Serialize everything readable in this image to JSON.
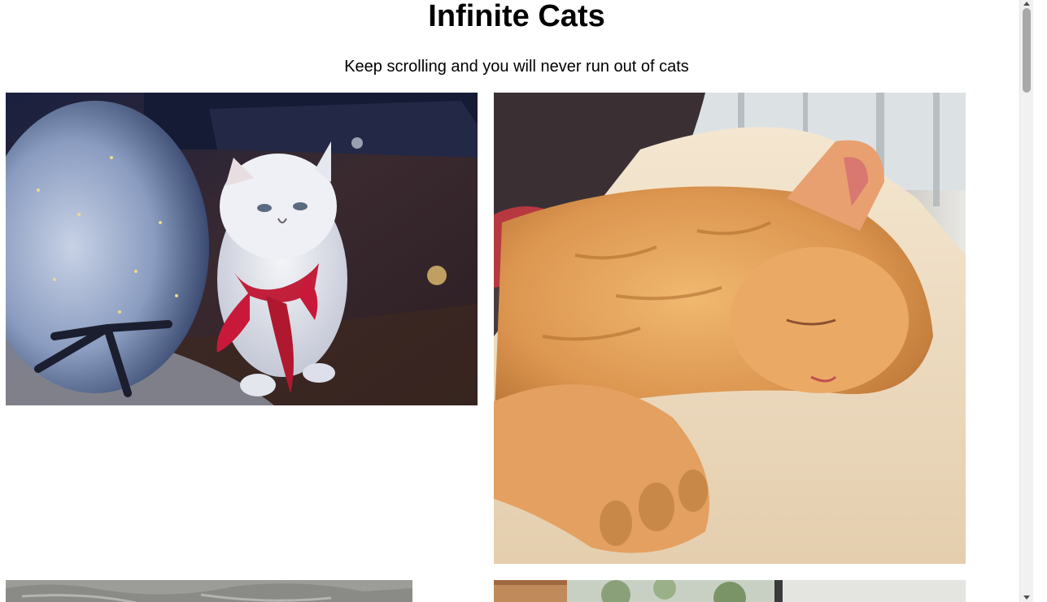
{
  "page": {
    "title": "Infinite Cats",
    "subtitle": "Keep scrolling and you will never run out of cats"
  },
  "cats": [
    {
      "subject": "white persian cat with red ribbon beside silver christmas tree"
    },
    {
      "subject": "sleeping orange tabby cat on cream blanket"
    },
    {
      "subject": "grey crumpled fabric (partially visible)"
    },
    {
      "subject": "window with trees outside (partially visible)"
    }
  ],
  "scrollbar": {
    "position_fraction": 0.0
  }
}
